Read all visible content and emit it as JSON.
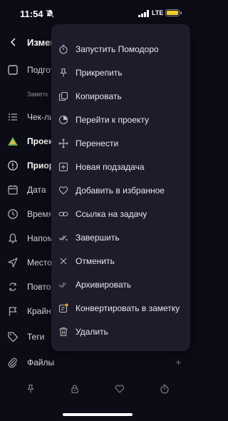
{
  "status_bar": {
    "time": "11:54",
    "network": "LTE"
  },
  "header": {
    "title": "Измен"
  },
  "underlay": {
    "rows": [
      {
        "label": "Подгот",
        "icon": "checkbox-icon"
      },
      {
        "label": "Заметк",
        "icon": ""
      },
      {
        "label": "Чек-ли",
        "icon": "list-icon"
      },
      {
        "label": "Проек",
        "icon": "project-icon"
      },
      {
        "label": "Приор",
        "icon": "priority-icon"
      },
      {
        "label": "Дата",
        "icon": "calendar-icon"
      },
      {
        "label": "Время",
        "icon": "clock-icon"
      },
      {
        "label": "Напом",
        "icon": "bell-icon"
      },
      {
        "label": "Место",
        "icon": "location-icon"
      },
      {
        "label": "Повто",
        "icon": "repeat-icon"
      },
      {
        "label": "Крайн",
        "icon": "flag-icon"
      },
      {
        "label": "Теги",
        "icon": "tag-icon"
      },
      {
        "label": "Файлы",
        "icon": "paperclip-icon"
      }
    ],
    "files_add": "+"
  },
  "menu": {
    "items": [
      {
        "label": "Запустить Помодоро",
        "icon": "timer-icon"
      },
      {
        "label": "Прикрепить",
        "icon": "pin-icon"
      },
      {
        "label": "Копировать",
        "icon": "copy-icon"
      },
      {
        "label": "Перейти к проекту",
        "icon": "project-circle-icon"
      },
      {
        "label": "Перенести",
        "icon": "move-icon"
      },
      {
        "label": "Новая подзадача",
        "icon": "add-subtask-icon"
      },
      {
        "label": "Добавить в избранное",
        "icon": "heart-icon"
      },
      {
        "label": "Ссылка на задачу",
        "icon": "link-icon"
      },
      {
        "label": "Завершить",
        "icon": "double-check-icon"
      },
      {
        "label": "Отменить",
        "icon": "close-icon"
      },
      {
        "label": "Архивировать",
        "icon": "archive-check-icon"
      },
      {
        "label": "Конвертировать в заметку",
        "icon": "note-convert-icon"
      },
      {
        "label": "Удалить",
        "icon": "trash-icon"
      }
    ]
  },
  "bottom_bar": {
    "icons": [
      "pin-icon",
      "lock-icon",
      "heart-icon",
      "timer-icon"
    ]
  },
  "colors": {
    "background": "#0c0c16",
    "menu_bg": "#1c1c2b",
    "battery": "#f2d02c",
    "accent_orange": "#f0a030"
  }
}
